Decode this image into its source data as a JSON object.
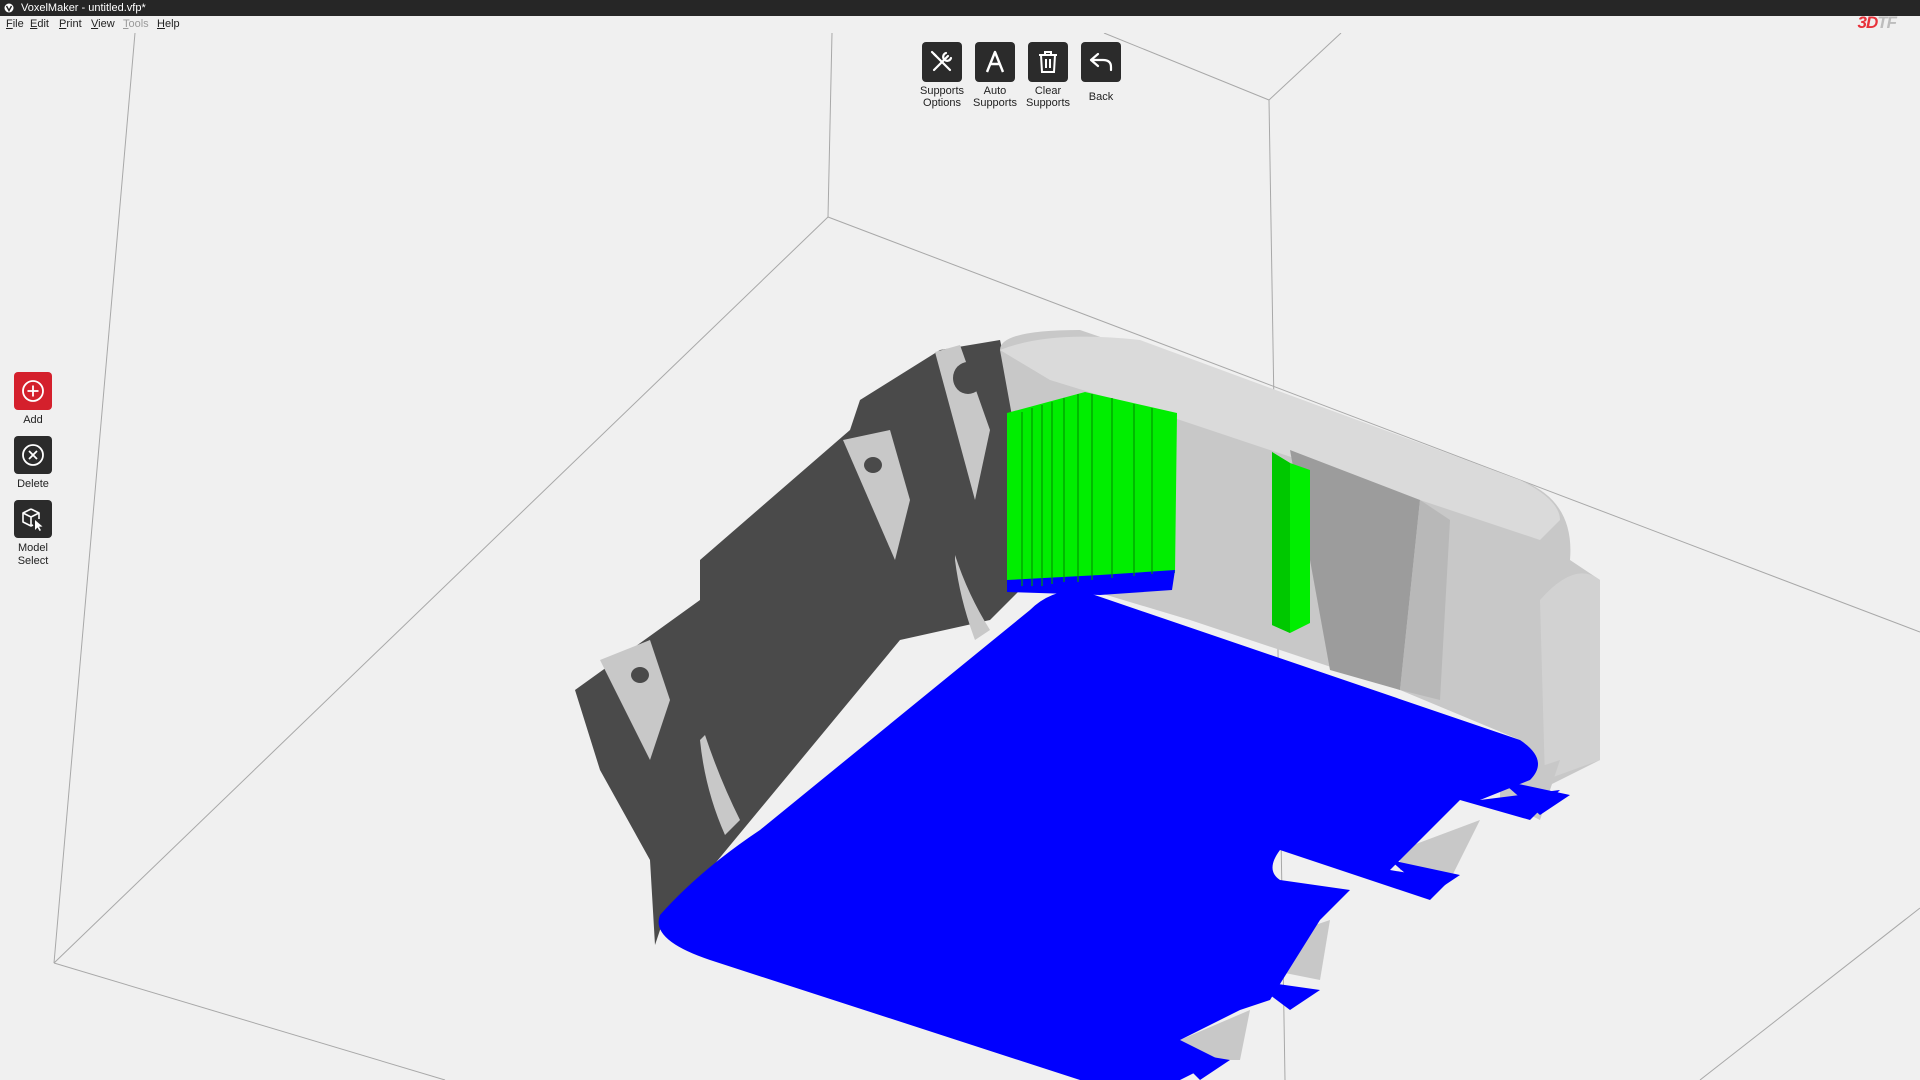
{
  "window": {
    "title": "VoxelMaker - untitled.vfp*",
    "brand_logo_primary": "3D",
    "brand_logo_secondary": "TF"
  },
  "menu": [
    {
      "label": "File",
      "mnemonic": "F",
      "rest": "ile",
      "enabled": true
    },
    {
      "label": "Edit",
      "mnemonic": "E",
      "rest": "dit",
      "enabled": true
    },
    {
      "label": "Print",
      "mnemonic": "P",
      "rest": "rint",
      "enabled": true
    },
    {
      "label": "View",
      "mnemonic": "V",
      "rest": "iew",
      "enabled": true
    },
    {
      "label": "Tools",
      "mnemonic": "T",
      "rest": "ools",
      "enabled": false
    },
    {
      "label": "Help",
      "mnemonic": "H",
      "rest": "elp",
      "enabled": true
    }
  ],
  "top_toolbar": {
    "supports_options": {
      "label": "Supports\nOptions",
      "icon": "wrench-screwdriver-icon"
    },
    "auto_supports": {
      "label": "Auto\nSupports",
      "icon": "letter-a-icon"
    },
    "clear_supports": {
      "label": "Clear\nSupports",
      "icon": "trash-icon"
    },
    "back": {
      "label": "Back",
      "icon": "back-arrow-icon"
    }
  },
  "left_toolbar": {
    "add": {
      "label": "Add",
      "icon": "plus-circle-icon"
    },
    "delete": {
      "label": "Delete",
      "icon": "x-circle-icon"
    },
    "model_select": {
      "label": "Model\nSelect",
      "icon": "cube-cursor-icon"
    }
  },
  "colors": {
    "titlebar_bg": "#262626",
    "viewport_bg": "#f0f0f0",
    "toolbar_icon_bg": "#2b2b2b",
    "add_button_bg": "#d4202c",
    "brand_red": "#e8323b",
    "model_light": "#c8c8c8",
    "model_dark": "#4a4a4a",
    "support_green": "#00ee00",
    "overhang_blue": "#0000ff"
  }
}
